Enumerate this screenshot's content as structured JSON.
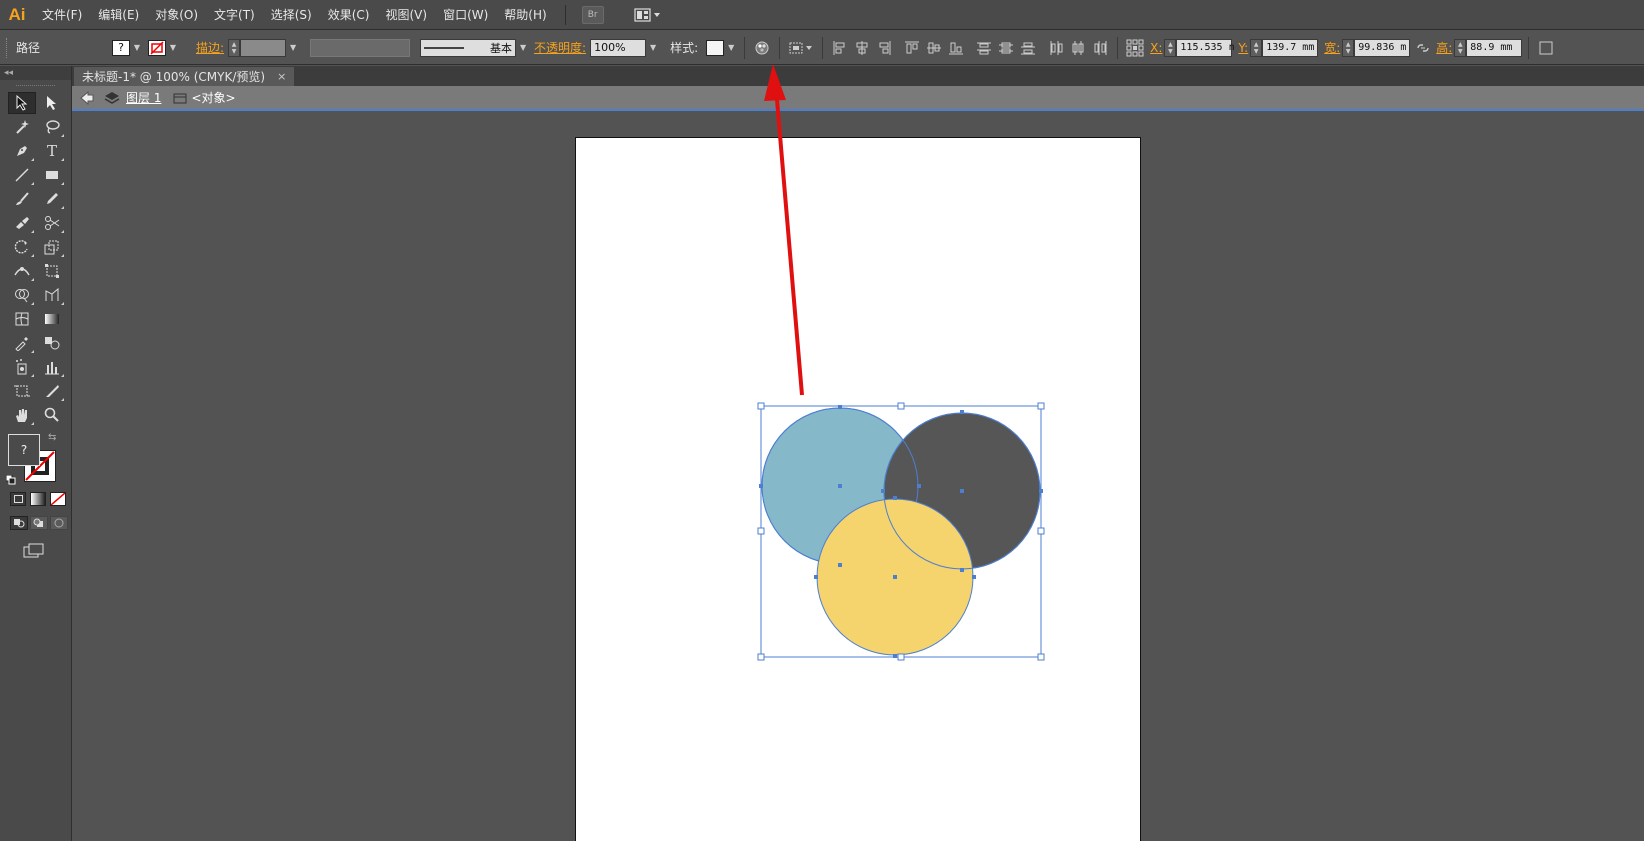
{
  "app": {
    "logo": "Ai"
  },
  "menu": {
    "items": [
      "文件(F)",
      "编辑(E)",
      "对象(O)",
      "文字(T)",
      "选择(S)",
      "效果(C)",
      "视图(V)",
      "窗口(W)",
      "帮助(H)"
    ],
    "bridge": "Br"
  },
  "control": {
    "object_type": "路径",
    "fill_value": "?",
    "stroke_label": "描边:",
    "stroke_profile": "基本",
    "opacity_label": "不透明度:",
    "opacity_value": "100%",
    "style_label": "样式:",
    "x_label": "X:",
    "x_value": "115.535 n",
    "y_label": "Y:",
    "y_value": "139.7 mm",
    "w_label": "宽:",
    "w_value": "99.836 m",
    "h_label": "高:",
    "h_value": "88.9 mm"
  },
  "document": {
    "tab_title": "未标题-1* @ 100% (CMYK/预览)",
    "close": "×",
    "layer": "图层 1",
    "object": "<对象>"
  },
  "toolbar": {
    "fill_question": "?"
  },
  "colors": {
    "circle_blue": "#85b8c9",
    "circle_dark": "#565656",
    "circle_yellow": "#f5d36d",
    "selection": "#4d7fd1",
    "arrow": "#e01010",
    "accent_orange": "#f7a21b"
  }
}
